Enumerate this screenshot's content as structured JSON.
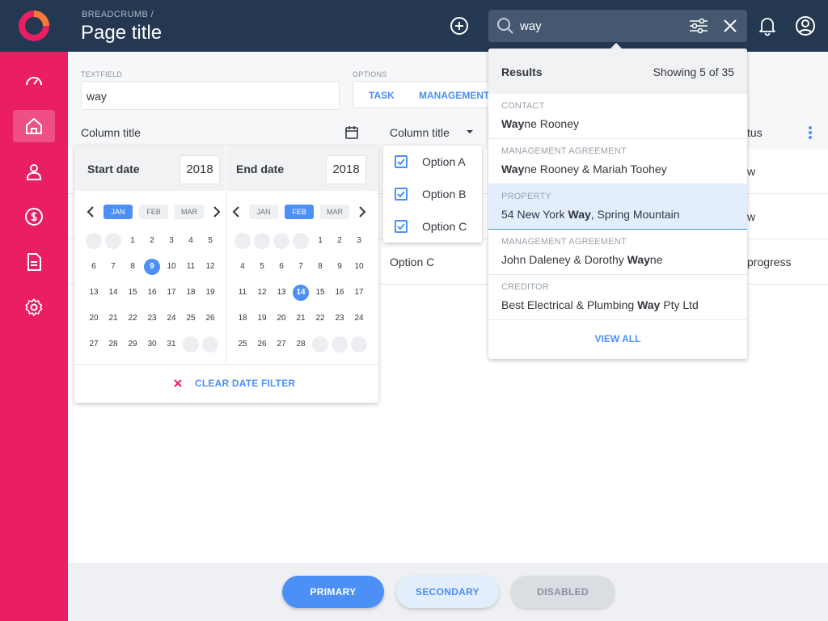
{
  "header": {
    "breadcrumb": "BREADCRUMB /",
    "title": "Page title",
    "search_value": "way"
  },
  "sidebar": {
    "items": [
      {
        "icon": "dashboard-icon"
      },
      {
        "icon": "home-icon",
        "active": true
      },
      {
        "icon": "user-icon"
      },
      {
        "icon": "dollar-icon"
      },
      {
        "icon": "document-icon"
      },
      {
        "icon": "settings-icon"
      }
    ]
  },
  "form": {
    "textfield_label": "TEXTFIELD",
    "textfield_value": "way",
    "options_label": "OPTIONS",
    "options": [
      "TASK",
      "MANAGEMENT"
    ]
  },
  "table": {
    "col1": "Column title",
    "col2": "Column title",
    "col3_partial": "tus",
    "rows": [
      {
        "col2": "",
        "col3": "w"
      },
      {
        "col2": "",
        "col3": "w"
      },
      {
        "col2": "Option C",
        "col3": "progress"
      }
    ]
  },
  "date_filter": {
    "start_label": "Start date",
    "start_year": "2018",
    "end_label": "End date",
    "end_year": "2018",
    "start_months": [
      "JAN",
      "FEB",
      "MAR"
    ],
    "end_months": [
      "JAN",
      "FEB",
      "MAR"
    ],
    "start_selected_month": "JAN",
    "end_selected_month": "FEB",
    "start_days": [
      "",
      "",
      "1",
      "2",
      "3",
      "4",
      "5",
      "6",
      "7",
      "8",
      "9",
      "10",
      "11",
      "12",
      "13",
      "14",
      "15",
      "16",
      "17",
      "18",
      "19",
      "20",
      "21",
      "22",
      "23",
      "24",
      "25",
      "26",
      "27",
      "28",
      "29",
      "30",
      "31",
      "",
      ""
    ],
    "start_selected_day": "9",
    "end_days": [
      "",
      "",
      "",
      "",
      "1",
      "2",
      "3",
      "4",
      "5",
      "6",
      "7",
      "8",
      "9",
      "10",
      "11",
      "12",
      "13",
      "14",
      "15",
      "16",
      "17",
      "18",
      "19",
      "20",
      "21",
      "22",
      "23",
      "24",
      "25",
      "26",
      "27",
      "28",
      "",
      "",
      ""
    ],
    "end_selected_day": "14",
    "clear_label": "CLEAR DATE FILTER"
  },
  "options_dropdown": {
    "items": [
      "Option A",
      "Option B",
      "Option C"
    ]
  },
  "results": {
    "title": "Results",
    "count": "Showing 5 of 35",
    "items": [
      {
        "category": "CONTACT",
        "bold": "Way",
        "rest": "ne Rooney",
        "pre": ""
      },
      {
        "category": "MANAGEMENT AGREEMENT",
        "bold": "Way",
        "rest": "ne Rooney & Mariah Toohey",
        "pre": ""
      },
      {
        "category": "PROPERTY",
        "pre": "54 New York ",
        "bold": "Way",
        "rest": ", Spring Mountain",
        "highlighted": true
      },
      {
        "category": "MANAGEMENT AGREEMENT",
        "pre": "John Daleney & Dorothy ",
        "bold": "Way",
        "rest": "ne"
      },
      {
        "category": "CREDITOR",
        "pre": "Best Electrical & Plumbing ",
        "bold": "Way",
        "rest": " Pty Ltd"
      }
    ],
    "view_all": "VIEW ALL"
  },
  "footer": {
    "primary": "PRIMARY",
    "secondary": "SECONDARY",
    "disabled": "DISABLED"
  },
  "colors": {
    "topbar": "#243852",
    "sidebar": "#e91e63",
    "accent": "#4c8ff5"
  }
}
